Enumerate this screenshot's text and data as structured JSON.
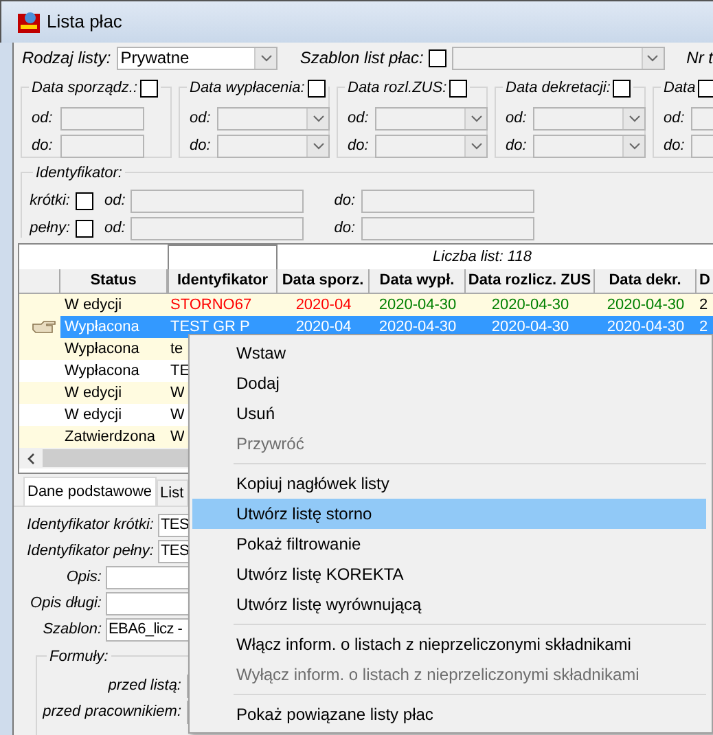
{
  "window": {
    "title": "Lista płac"
  },
  "filters": {
    "type_label": "Rodzaj listy:",
    "type_value": "Prywatne",
    "template_label": "Szablon list płac:",
    "template_checked": false,
    "next_label": "Nr t"
  },
  "date_groups": [
    {
      "label": "Data sporządz.:",
      "checked": false,
      "kind": "text",
      "from": "od:",
      "to": "do:"
    },
    {
      "label": "Data wypłacenia:",
      "checked": false,
      "kind": "combo",
      "from": "od:",
      "to": "do:"
    },
    {
      "label": "Data rozl.ZUS:",
      "checked": false,
      "kind": "combo",
      "from": "od:",
      "to": "do:"
    },
    {
      "label": "Data dekretacji:",
      "checked": false,
      "kind": "combo",
      "from": "od:",
      "to": "do:"
    },
    {
      "label": "Data",
      "checked": false,
      "kind": "combo",
      "from": "od:",
      "to": "do:"
    }
  ],
  "identifier_group": {
    "label": "Identyfikator:",
    "rows": [
      {
        "label": "krótki:",
        "checked": false,
        "from": "od:",
        "to": "do:"
      },
      {
        "label": "pełny:",
        "checked": false,
        "from": "od:",
        "to": "do:"
      }
    ]
  },
  "table": {
    "count": "Liczba list: 118",
    "columns": [
      "Status",
      "Identyfikator",
      "Data sporz.",
      "Data wypł.",
      "Data rozlicz. ZUS",
      "Data dekr.",
      "D"
    ],
    "rows": [
      {
        "selected": false,
        "shaded": true,
        "cells": [
          {
            "text": "W edycji"
          },
          {
            "text": "STORNO67",
            "color": "#ff0000"
          },
          {
            "text": "2020-04",
            "color": "#ff0000"
          },
          {
            "text": "2020-04-30",
            "color": "#008000"
          },
          {
            "text": "2020-04-30",
            "color": "#008000"
          },
          {
            "text": "2020-04-30",
            "color": "#008000"
          },
          {
            "text": "2"
          }
        ]
      },
      {
        "selected": true,
        "shaded": true,
        "cells": [
          {
            "text": "Wypłacona"
          },
          {
            "text": "TEST GR P"
          },
          {
            "text": "2020-04"
          },
          {
            "text": "2020-04-30"
          },
          {
            "text": "2020-04-30"
          },
          {
            "text": "2020-04-30"
          },
          {
            "text": "2"
          }
        ]
      },
      {
        "selected": false,
        "shaded": true,
        "cells": [
          {
            "text": "Wypłacona"
          },
          {
            "text": "te"
          }
        ]
      },
      {
        "selected": false,
        "shaded": false,
        "cells": [
          {
            "text": "Wypłacona"
          },
          {
            "text": "TE"
          }
        ]
      },
      {
        "selected": false,
        "shaded": true,
        "cells": [
          {
            "text": "W edycji"
          },
          {
            "text": "W"
          }
        ]
      },
      {
        "selected": false,
        "shaded": false,
        "cells": [
          {
            "text": "W edycji"
          },
          {
            "text": "W"
          }
        ]
      },
      {
        "selected": false,
        "shaded": true,
        "cells": [
          {
            "text": "Zatwierdzona"
          },
          {
            "text": "W"
          }
        ]
      }
    ]
  },
  "tabs": [
    {
      "label": "Dane podstawowe",
      "selected": true
    },
    {
      "label": "List",
      "selected": false
    }
  ],
  "details": [
    {
      "label": "Identyfikator krótki:",
      "value": "TES",
      "indent": false
    },
    {
      "label": "Identyfikator pełny:",
      "value": "TES",
      "indent": false
    },
    {
      "label": "Opis:",
      "indent": true
    },
    {
      "label": "Opis długi:",
      "indent": true
    },
    {
      "label": "Szablon:",
      "value": "EBA6_licz -",
      "indent": true
    }
  ],
  "formulas": {
    "label": "Formuły:",
    "rows": [
      {
        "label": "przed listą:"
      },
      {
        "label": "przed pracownikiem:"
      }
    ]
  },
  "context_menu": [
    {
      "kind": "item",
      "label": "Wstaw",
      "disabled": false,
      "selected": false
    },
    {
      "kind": "item",
      "label": "Dodaj",
      "disabled": false,
      "selected": false
    },
    {
      "kind": "item",
      "label": "Usuń",
      "disabled": false,
      "selected": false
    },
    {
      "kind": "item",
      "label": "Przywróć",
      "disabled": true,
      "selected": false
    },
    {
      "kind": "separator"
    },
    {
      "kind": "item",
      "label": "Kopiuj nagłówek listy",
      "disabled": false,
      "selected": false
    },
    {
      "kind": "item",
      "label": "Utwórz listę storno",
      "disabled": false,
      "selected": true
    },
    {
      "kind": "item",
      "label": "Pokaż filtrowanie",
      "disabled": false,
      "selected": false
    },
    {
      "kind": "item",
      "label": "Utwórz listę KOREKTA",
      "disabled": false,
      "selected": false
    },
    {
      "kind": "item",
      "label": "Utwórz listę wyrównującą",
      "disabled": false,
      "selected": false
    },
    {
      "kind": "separator"
    },
    {
      "kind": "item",
      "label": "Włącz inform. o listach z nieprzeliczonymi składnikami",
      "disabled": false,
      "selected": false
    },
    {
      "kind": "item",
      "label": "Wyłącz inform. o listach z nieprzeliczonymi składnikami",
      "disabled": true,
      "selected": false
    },
    {
      "kind": "separator"
    },
    {
      "kind": "item",
      "label": "Pokaż powiązane listy płac",
      "disabled": false,
      "selected": false
    }
  ]
}
